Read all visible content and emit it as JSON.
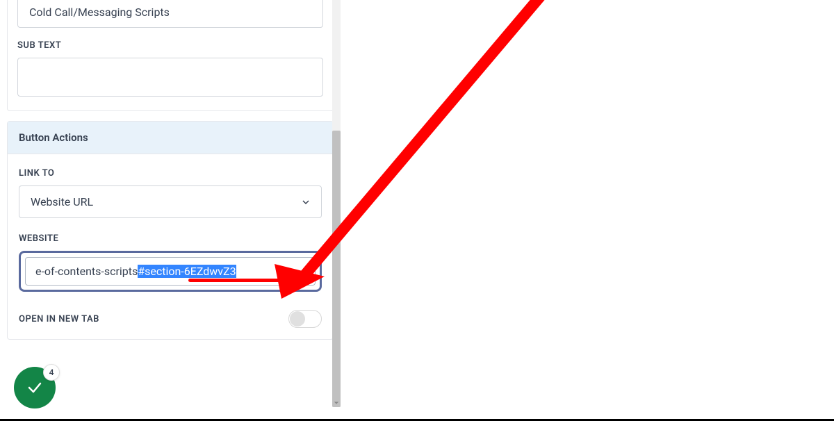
{
  "top": {
    "title_value": "Cold Call/Messaging Scripts",
    "subtext_label": "SUB TEXT",
    "subtext_value": ""
  },
  "button_actions": {
    "header": "Button Actions",
    "link_to_label": "LINK TO",
    "link_to_value": "Website URL",
    "website_label": "WEBSITE",
    "website_value_plain": "e-of-contents-scripts",
    "website_value_highlight": "#section-6EZdwvZ3",
    "open_new_tab_label": "OPEN IN NEW TAB",
    "open_new_tab_value": false
  },
  "fab": {
    "badge_count": "4"
  }
}
